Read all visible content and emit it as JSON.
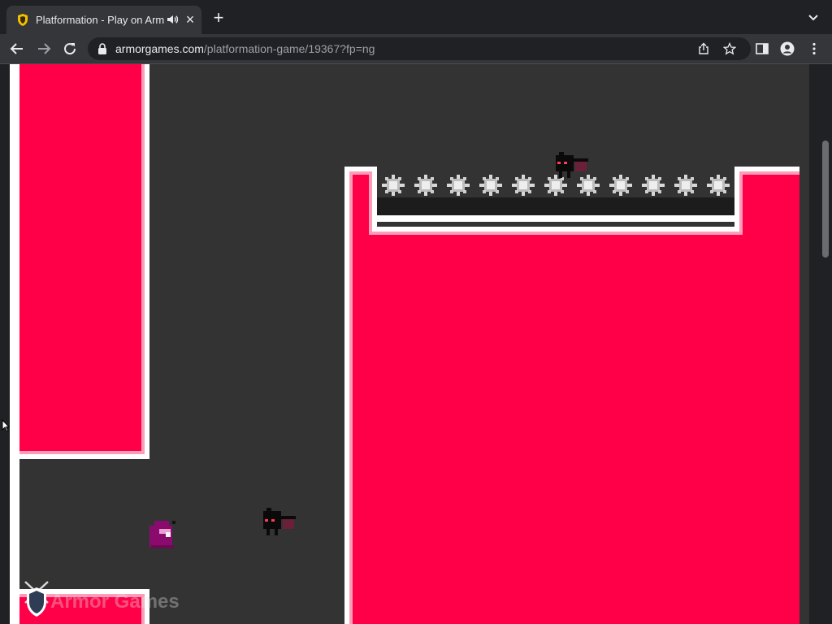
{
  "browser": {
    "tab": {
      "title": "Platformation - Play on Arm",
      "close_glyph": "×",
      "favicon": "armor-games-shield-icon",
      "audio": "speaker-icon"
    },
    "new_tab_glyph": "+",
    "toolbar": {
      "back": "back-arrow-icon",
      "forward": "forward-arrow-icon",
      "reload": "reload-icon"
    },
    "omnibox": {
      "url_domain": "armorgames.com",
      "url_path": "/platformation-game/19367?fp=ng"
    }
  },
  "game": {
    "logo_text": "Armor Games"
  },
  "colors": {
    "pink": "#ff0048",
    "pink_edge": "#ff9cb8",
    "floor": "#333333",
    "chrome_dark": "#202124",
    "chrome": "#35363a"
  }
}
